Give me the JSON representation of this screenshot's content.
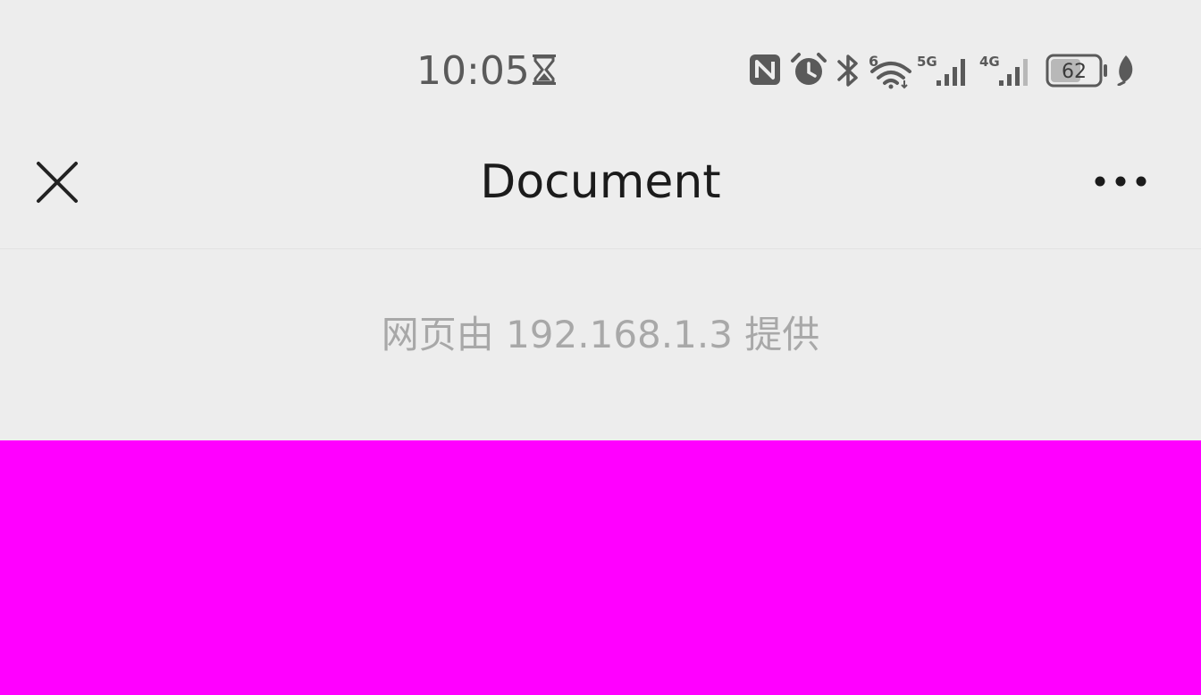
{
  "status_bar": {
    "time": "10:05",
    "battery_level": "62",
    "network_labels": [
      "6",
      "5G",
      "4G"
    ],
    "icon_color": "#5a5a5a"
  },
  "title_bar": {
    "title": "Document",
    "close_icon": "close-icon",
    "more_icon": "more-horizontal-icon"
  },
  "provider": {
    "text": "网页由 192.168.1.3 提供"
  },
  "content": {
    "background_color": "#ff00ff"
  },
  "colors": {
    "background": "#ededed",
    "title": "#1b1b1b",
    "provider_text": "#a8a8a8"
  }
}
